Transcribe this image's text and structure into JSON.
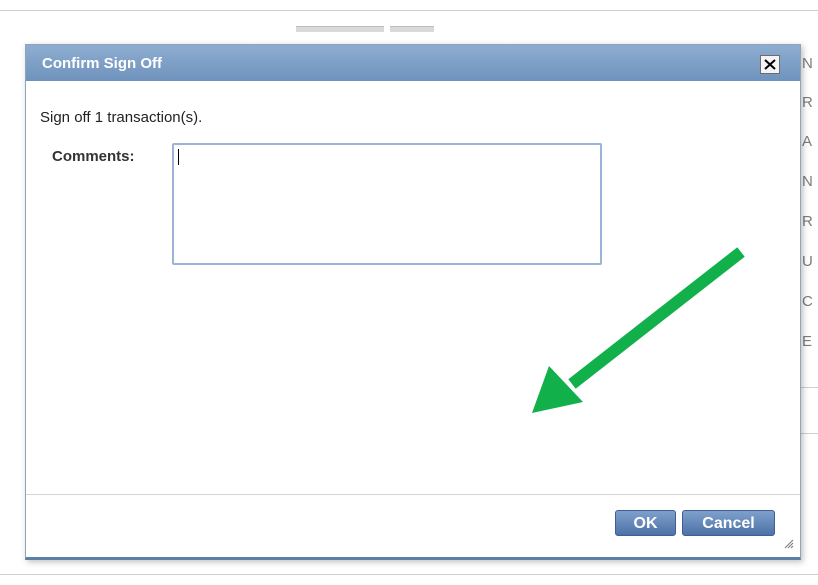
{
  "background": {
    "right_edge_letters": [
      "N",
      "R",
      "A",
      "N",
      "R",
      "U",
      "C",
      "E"
    ]
  },
  "dialog": {
    "title": "Confirm Sign Off",
    "close_label": "×",
    "summary": "Sign off 1 transaction(s).",
    "comments_label": "Comments:",
    "comments_value": "",
    "ok_label": "OK",
    "cancel_label": "Cancel"
  },
  "annotation": {
    "arrow_color": "#11b04a"
  },
  "colors": {
    "titlebar": "#7c9dc6",
    "button": "#5a7fb3",
    "field_border": "#9bb3d6"
  }
}
